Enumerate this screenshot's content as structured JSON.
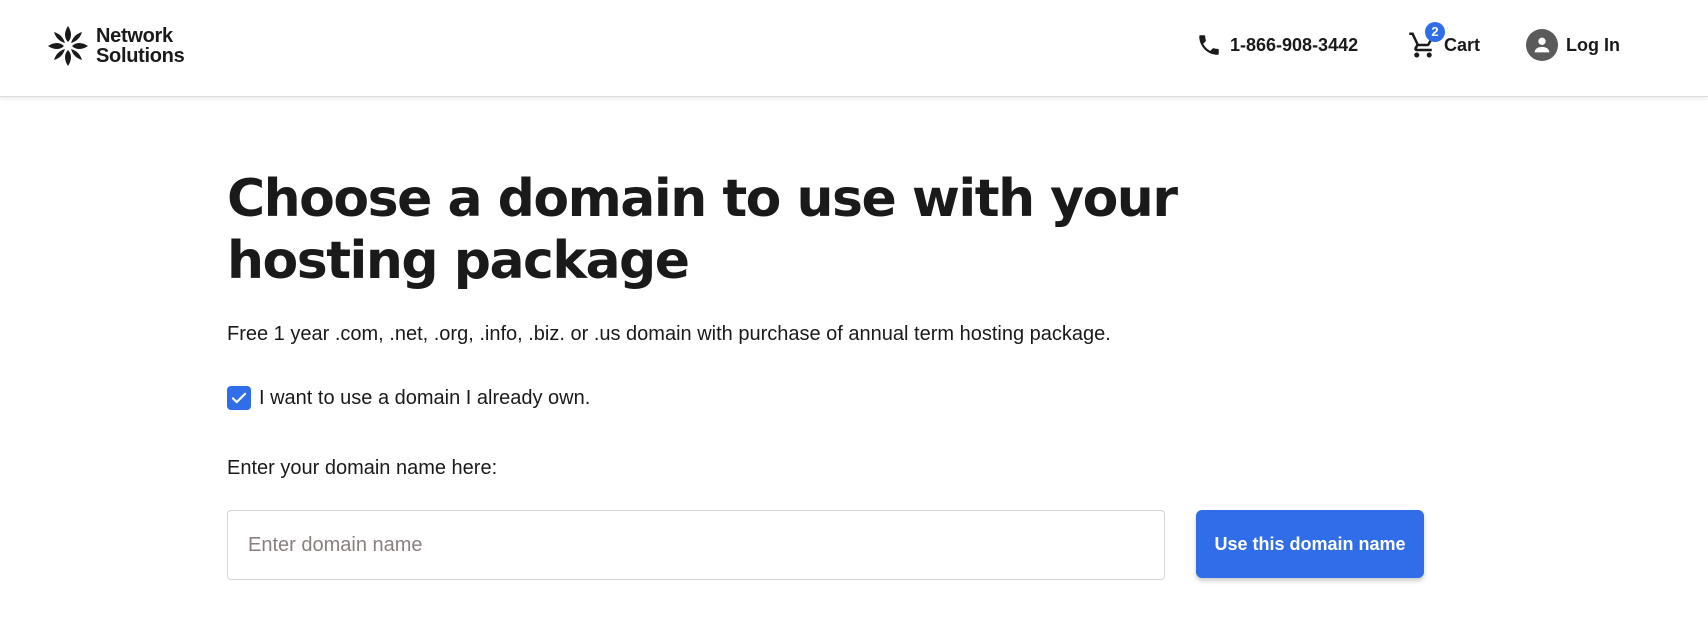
{
  "header": {
    "logo": {
      "line1": "Network",
      "line2": "Solutions"
    },
    "phone": "1-866-908-3442",
    "cart": {
      "label": "Cart",
      "count": "2"
    },
    "login": "Log In"
  },
  "main": {
    "title": "Choose a domain to use with your hosting package",
    "subtitle": "Free 1 year .com, .net, .org, .info, .biz. or .us domain with purchase of annual term hosting package.",
    "checkbox": {
      "label": "I want to use a domain I already own.",
      "checked": true
    },
    "field_label": "Enter your domain name here:",
    "input": {
      "placeholder": "Enter domain name",
      "value": ""
    },
    "button_label": "Use this domain name"
  },
  "colors": {
    "accent": "#2f6ee8",
    "text": "#1a1a1a",
    "avatar": "#5a5a5a"
  },
  "icons": [
    "logo-icon",
    "phone-icon",
    "cart-icon",
    "user-icon",
    "checkmark-icon"
  ]
}
